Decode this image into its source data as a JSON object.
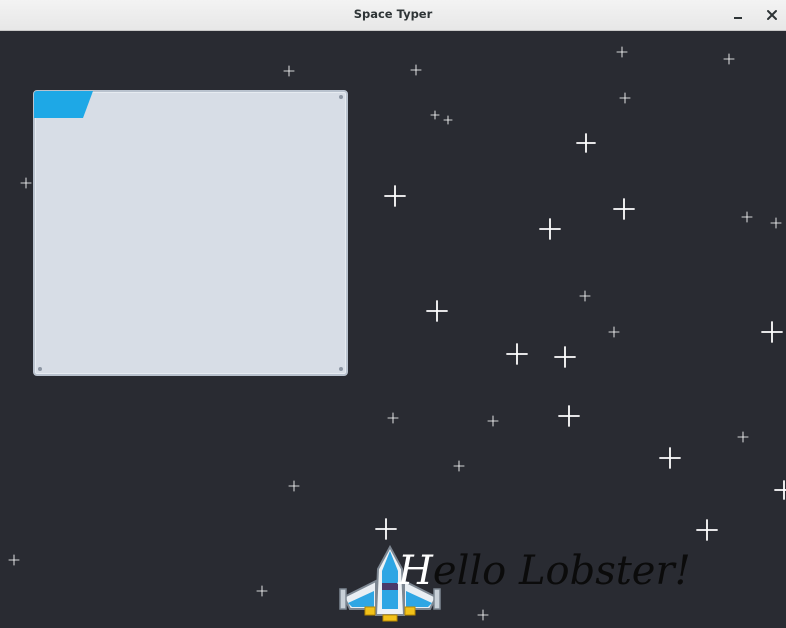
{
  "window": {
    "title": "Space Typer",
    "minimize_icon": "minimize-icon",
    "close_icon": "close-icon"
  },
  "game": {
    "typed_text": "H",
    "remaining_text": "ello Lobster!",
    "colors": {
      "background": "#292b32",
      "panel": "#d7dde6",
      "panel_tab": "#1ea8e6",
      "star": "#ffffff",
      "typed": "#ffffff",
      "untyped": "#0b0b0b"
    }
  }
}
